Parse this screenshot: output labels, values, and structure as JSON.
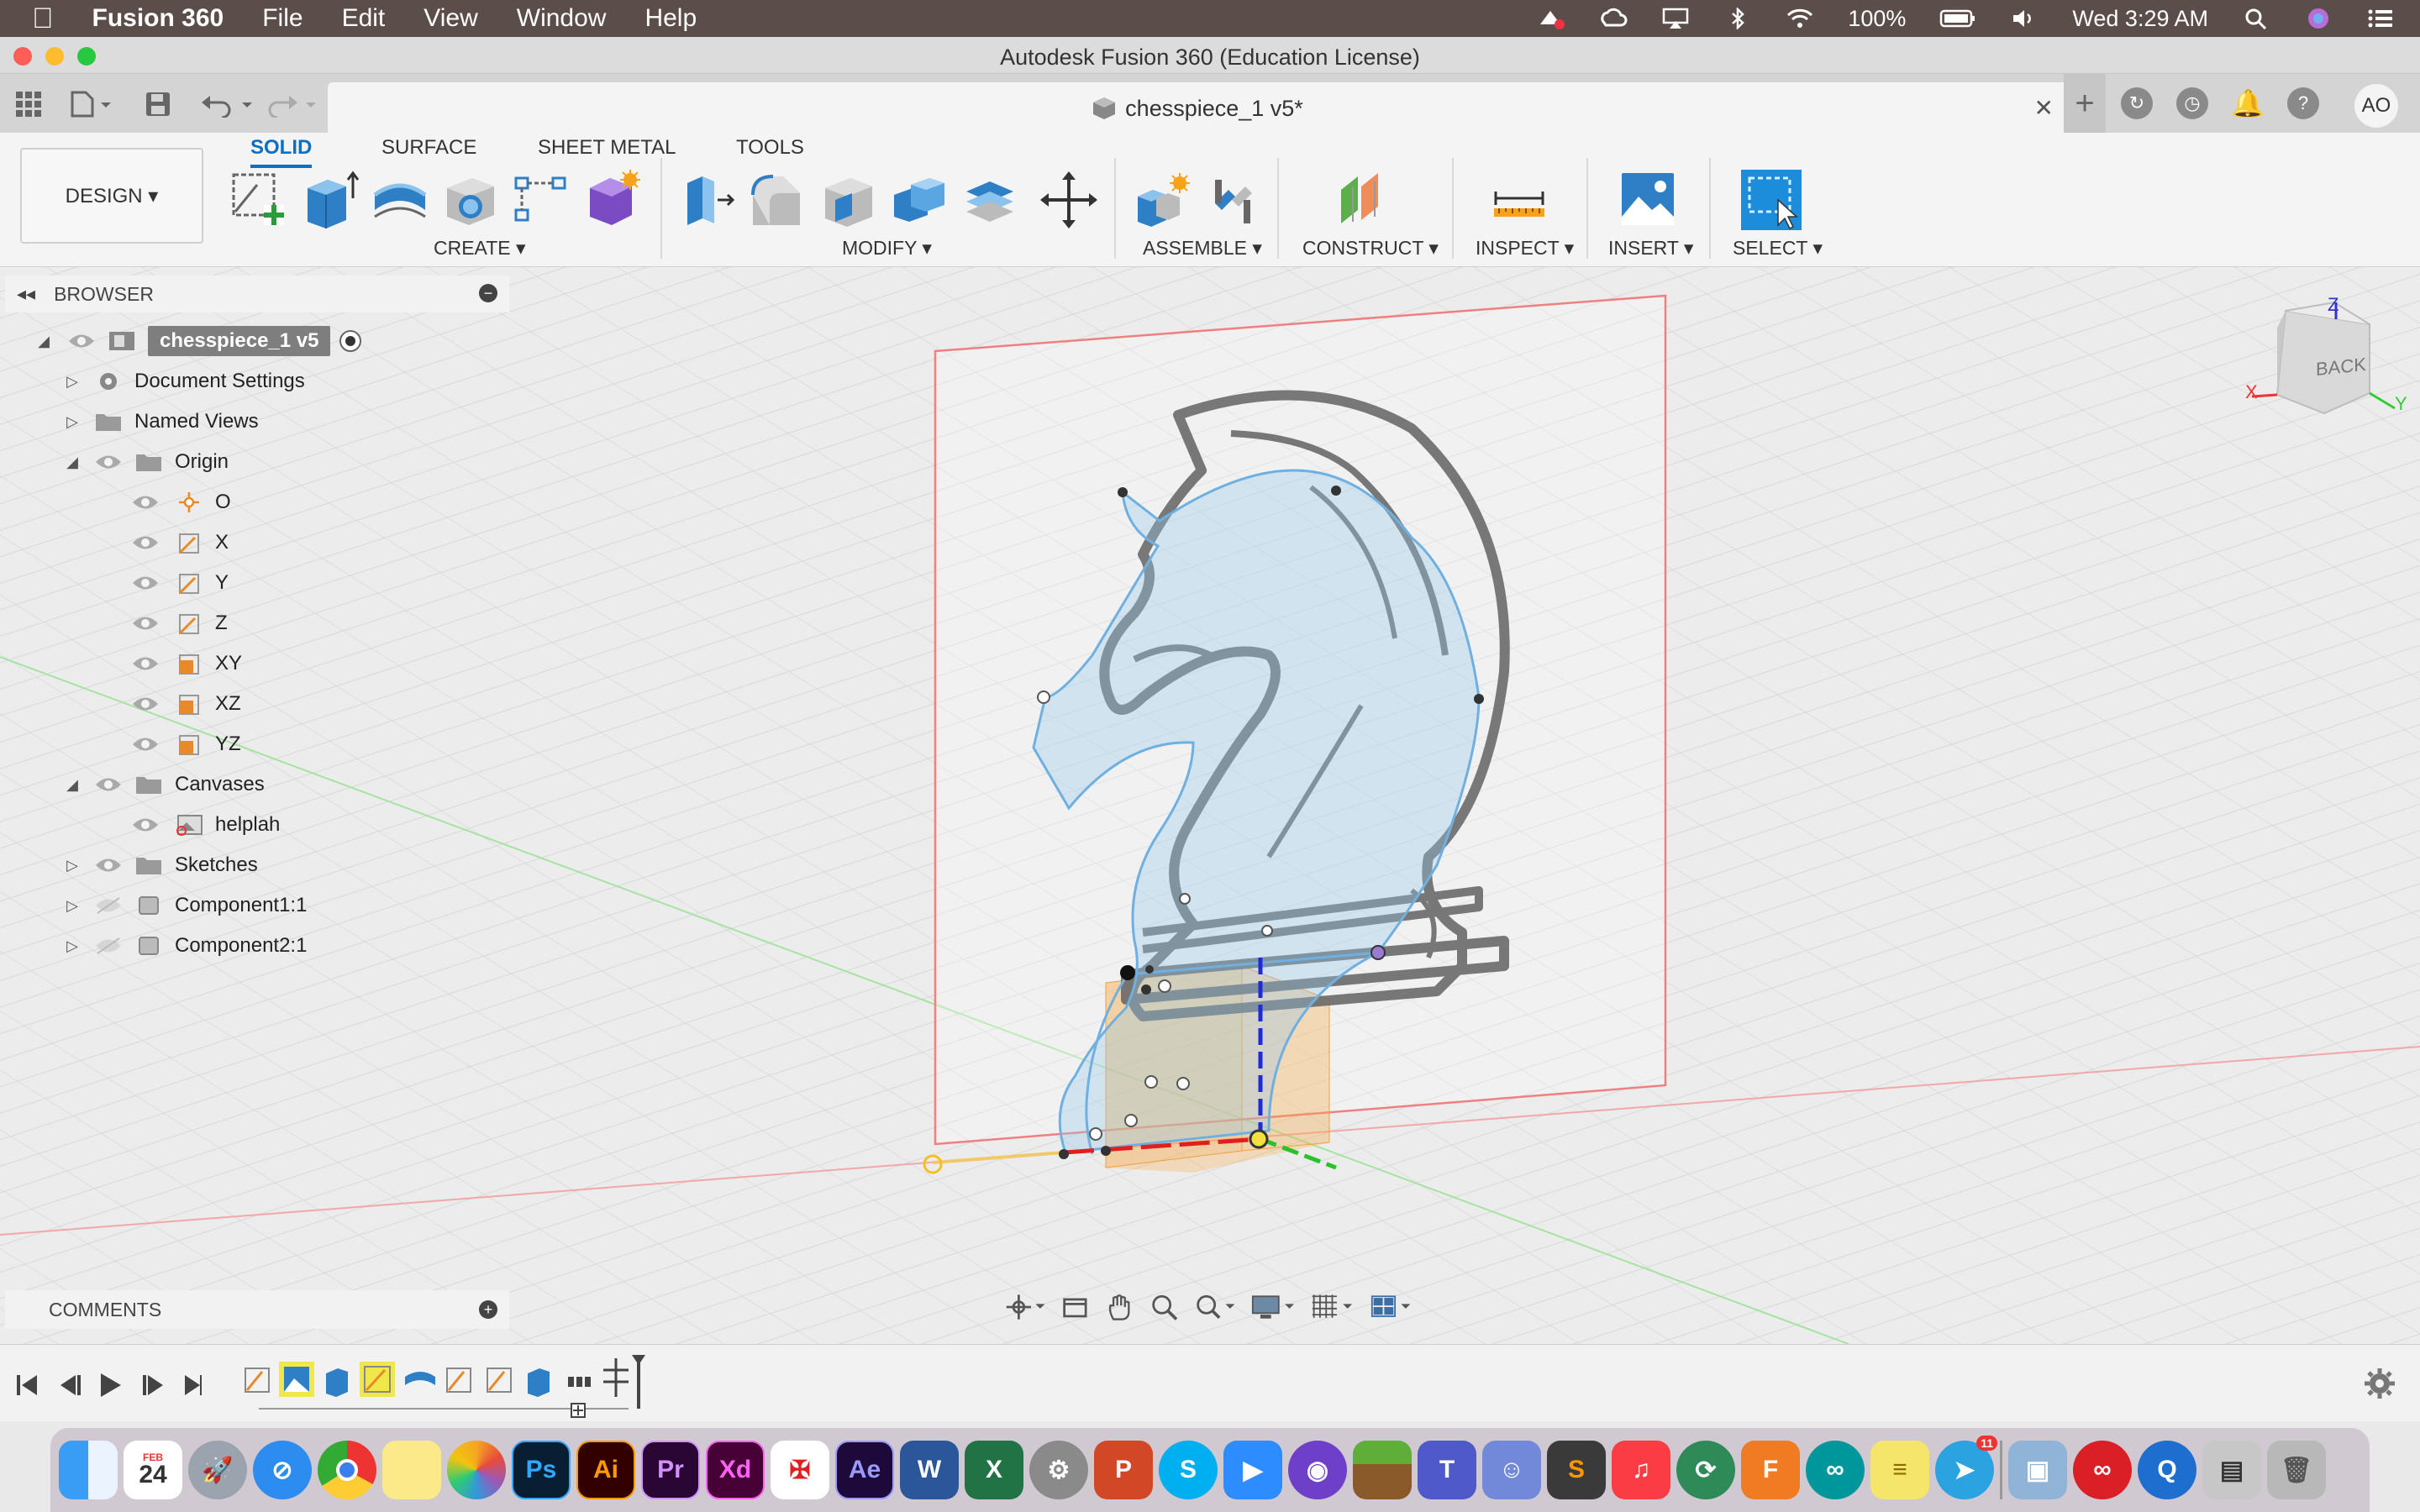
{
  "menubar": {
    "apple": "",
    "app": "Fusion 360",
    "menus": [
      "File",
      "Edit",
      "View",
      "Window",
      "Help"
    ],
    "battery": "100%",
    "clock": "Wed 3:29 AM"
  },
  "window": {
    "title": "Autodesk Fusion 360 (Education License)"
  },
  "tabbar": {
    "doc_name": "chesspiece_1 v5*",
    "close": "✕",
    "avatar": "AO"
  },
  "toolbar": {
    "design": "DESIGN ▾",
    "tabs": [
      "SOLID",
      "SURFACE",
      "SHEET METAL",
      "TOOLS"
    ],
    "groups": [
      "CREATE ▾",
      "MODIFY ▾",
      "ASSEMBLE ▾",
      "CONSTRUCT ▾",
      "INSPECT ▾",
      "INSERT ▾",
      "SELECT ▾"
    ]
  },
  "browser": {
    "title": "BROWSER",
    "root": "chesspiece_1 v5",
    "items": [
      "Document Settings",
      "Named Views",
      "Origin",
      "O",
      "X",
      "Y",
      "Z",
      "XY",
      "XZ",
      "YZ",
      "Canvases",
      "helplah",
      "Sketches",
      "Component1:1",
      "Component2:1"
    ]
  },
  "comments": {
    "title": "COMMENTS"
  },
  "viewcube": {
    "face": "BACK",
    "x_axis": "X",
    "z_axis": "Z",
    "y_axis": "Y"
  },
  "colors": {
    "accent": "#0b6fc4",
    "menubar": "#5b4e4a",
    "sketch_blue": "#7bb6e0",
    "plane_red": "#f08080"
  },
  "dock": {
    "apps": [
      "Finder",
      "Calendar",
      "Launchpad",
      "Safari",
      "Chrome",
      "Notes",
      "Photos",
      "Ps",
      "Ai",
      "Pr",
      "Xd",
      "Acrobat",
      "Ae",
      "W",
      "X",
      "System Preferences",
      "PowerPoint",
      "Skype",
      "Zoom",
      "GitHub",
      "Minecraft",
      "Teams",
      "Discord",
      "Sublime",
      "Music",
      "Xcode",
      "Fusion",
      "Arduino",
      "Stickies",
      "Telegram",
      "Preview",
      "Creative Cloud",
      "QuickTime",
      "Files",
      "Trash"
    ],
    "calendar_month": "FEB",
    "calendar_day": "24",
    "telegram_badge": "11"
  }
}
